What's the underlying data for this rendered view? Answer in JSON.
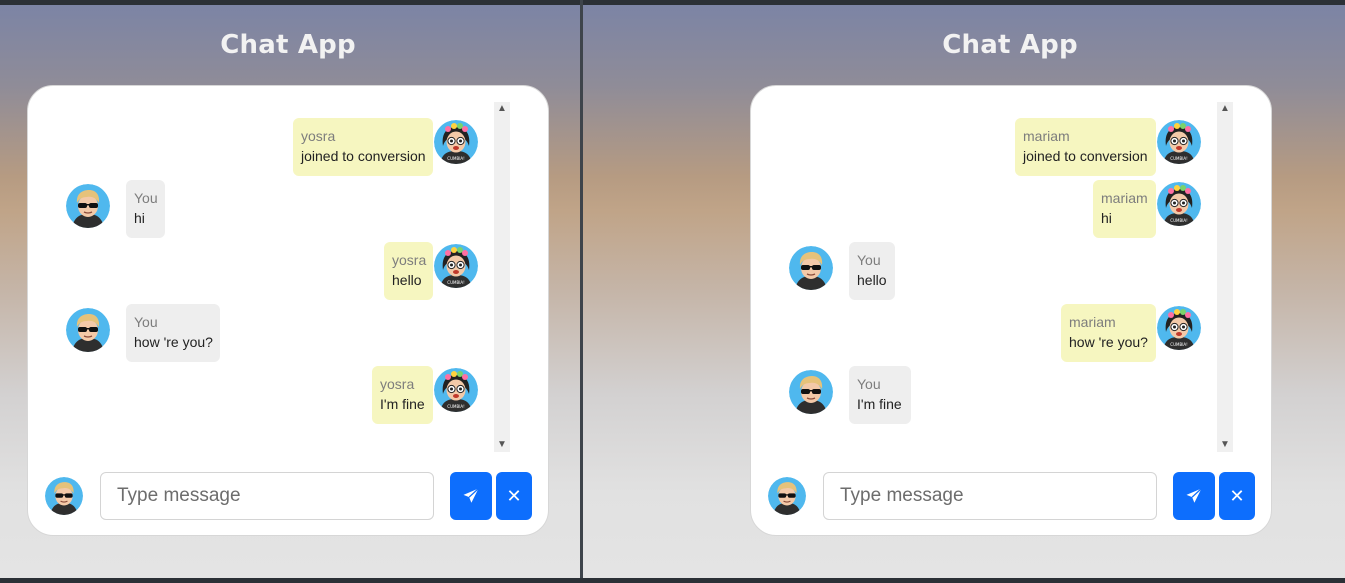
{
  "left_window": {
    "title": "Chat App",
    "messages": [
      {
        "side": "right",
        "name": "yosra",
        "text": "joined to conversion"
      },
      {
        "side": "left",
        "name": "You",
        "text": "hi"
      },
      {
        "side": "right",
        "name": "yosra",
        "text": "hello"
      },
      {
        "side": "left",
        "name": "You",
        "text": "how 're you?"
      },
      {
        "side": "right",
        "name": "yosra",
        "text": "I'm fine"
      }
    ],
    "composer": {
      "placeholder": "Type message"
    }
  },
  "right_window": {
    "title": "Chat App",
    "messages": [
      {
        "side": "right",
        "name": "mariam",
        "text": "joined to conversion"
      },
      {
        "side": "right",
        "name": "mariam",
        "text": "hi"
      },
      {
        "side": "left",
        "name": "You",
        "text": "hello"
      },
      {
        "side": "right",
        "name": "mariam",
        "text": "how 're you?"
      },
      {
        "side": "left",
        "name": "You",
        "text": "I'm fine"
      }
    ],
    "composer": {
      "placeholder": "Type message"
    }
  },
  "icons": {
    "send": "paper-plane-icon",
    "close": "close-icon",
    "scroll_up": "chevron-up-icon",
    "scroll_down": "chevron-down-icon"
  },
  "colors": {
    "accent": "#0d6efd",
    "other_bubble": "#f6f6c0",
    "own_bubble": "#eeeeee"
  }
}
